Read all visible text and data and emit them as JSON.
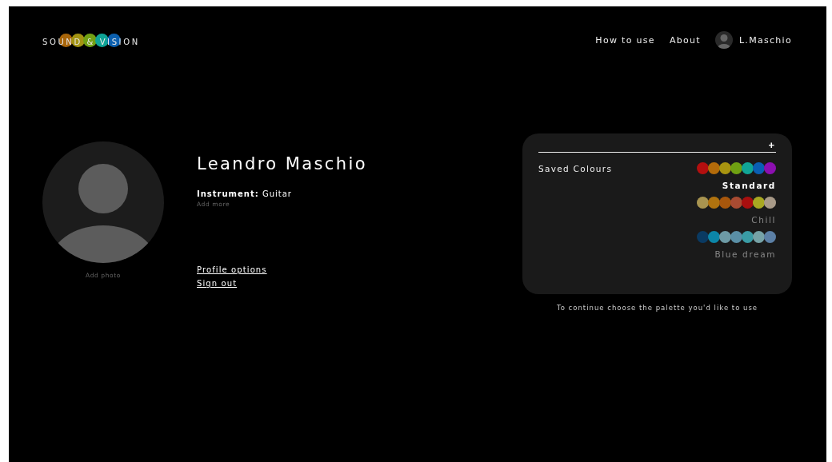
{
  "logo": {
    "text": "SOUND & VISION",
    "dots": [
      {
        "color": "#a8650a"
      },
      {
        "color": "#a39312"
      },
      {
        "color": "#72a114"
      },
      {
        "color": "#0fa396"
      },
      {
        "color": "#0b5fae"
      }
    ]
  },
  "nav": [
    {
      "label": "How to use"
    },
    {
      "label": "About"
    }
  ],
  "user": {
    "name": "L.Maschio"
  },
  "profile": {
    "photo_hint": "Add photo",
    "name": "Leandro Maschio",
    "instrument_label": "Instrument:",
    "instrument": "Guitar",
    "add_more": "Add more",
    "links": [
      "Profile options",
      "Sign out"
    ]
  },
  "palettes_card": {
    "add": "+",
    "title": "Saved Colours",
    "palettes": [
      {
        "name": "Standard",
        "selected": true,
        "colors": [
          {
            "color": "#b30f0f"
          },
          {
            "color": "#b36b0a"
          },
          {
            "color": "#a89410"
          },
          {
            "color": "#6fa012"
          },
          {
            "color": "#10a596"
          },
          {
            "color": "#0a5fb3"
          },
          {
            "color": "#8c0fb0"
          }
        ]
      },
      {
        "name": "Chill",
        "selected": false,
        "colors": [
          {
            "color": "#a89450"
          },
          {
            "color": "#b0730f"
          },
          {
            "color": "#a8570c"
          },
          {
            "color": "#a84b32"
          },
          {
            "color": "#a80f0f"
          },
          {
            "color": "#a8a822"
          },
          {
            "color": "#a89a88"
          }
        ]
      },
      {
        "name": "Blue dream",
        "selected": false,
        "colors": [
          {
            "color": "#0a3a62"
          },
          {
            "color": "#0c86a8"
          },
          {
            "color": "#6d9aa5"
          },
          {
            "color": "#5a8fa6"
          },
          {
            "color": "#3a9ca5"
          },
          {
            "color": "#76a2a6"
          },
          {
            "color": "#5c80a6"
          }
        ]
      }
    ]
  },
  "hint": "To continue choose the palette you'd like to use"
}
